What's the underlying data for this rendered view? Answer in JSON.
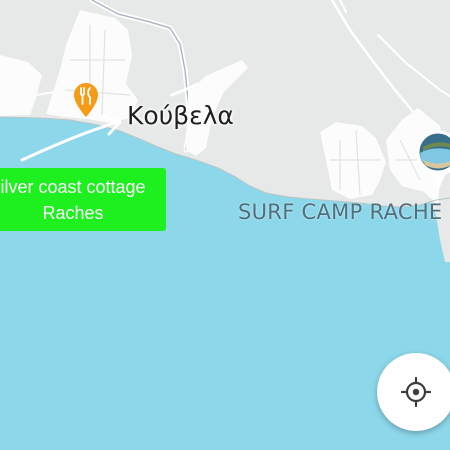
{
  "map": {
    "colors": {
      "water": "#8cd7ea",
      "land": "#e6e9e8",
      "roads": "#ffffff",
      "accent_green": "#1eef1e",
      "poi_orange": "#f59b18"
    },
    "labels": {
      "town": "Κούβελα",
      "surf_camp": "SURF CAMP RACHE",
      "property_line1": "ilver coast cottage",
      "property_line2": "Raches"
    },
    "markers": [
      {
        "type": "restaurant",
        "icon": "fork-knife-icon"
      },
      {
        "type": "photo-pin",
        "icon": "photo-thumbnail"
      }
    ],
    "controls": {
      "locate": "my-location-icon"
    }
  }
}
